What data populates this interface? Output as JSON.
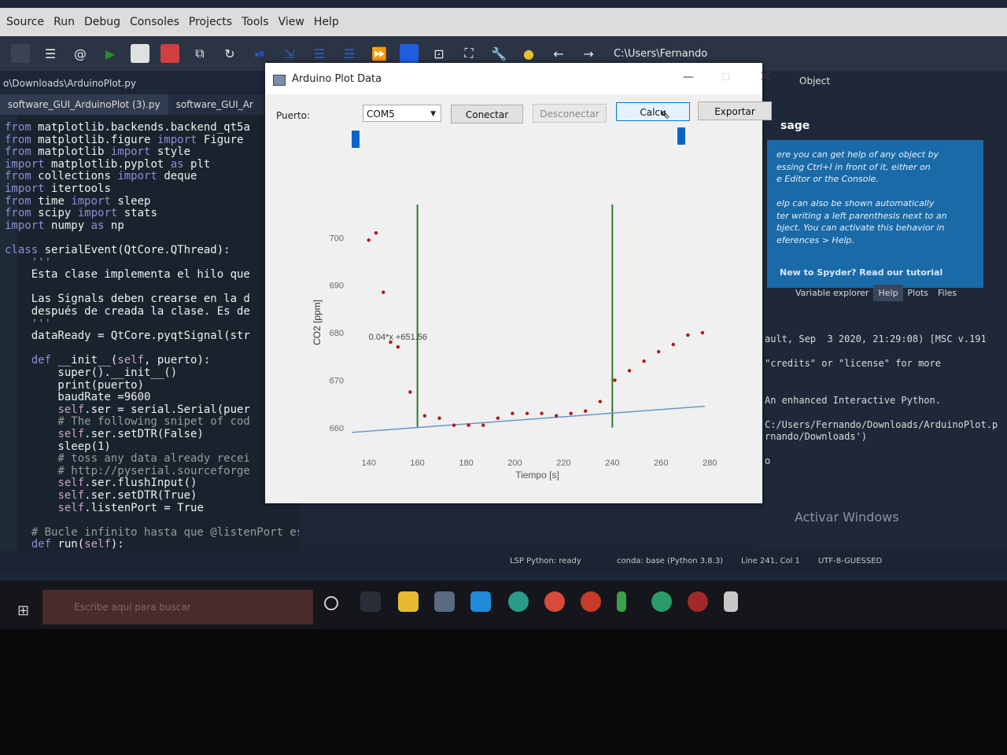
{
  "ide": {
    "menu": [
      "Source",
      "Run",
      "Debug",
      "Consoles",
      "Projects",
      "Tools",
      "View",
      "Help"
    ],
    "toolbar_path": "C:\\Users\\Fernando",
    "file_path": "o\\Downloads\\ArduinoPlot.py",
    "file_tabs": [
      "software_GUI_ArduinoPlot (3).py",
      "software_GUI_Ar"
    ],
    "code": [
      {
        "parts": [
          {
            "t": "from ",
            "c": "kw"
          },
          {
            "t": "matplotlib.backends.backend_qt5a",
            "c": ""
          }
        ]
      },
      {
        "parts": [
          {
            "t": "from ",
            "c": "kw"
          },
          {
            "t": "matplotlib.figure ",
            "c": ""
          },
          {
            "t": "import ",
            "c": "kw"
          },
          {
            "t": "Figure",
            "c": ""
          }
        ]
      },
      {
        "parts": [
          {
            "t": "from ",
            "c": "kw"
          },
          {
            "t": "matplotlib ",
            "c": ""
          },
          {
            "t": "import ",
            "c": "kw"
          },
          {
            "t": "style",
            "c": ""
          }
        ]
      },
      {
        "parts": [
          {
            "t": "import ",
            "c": "kw"
          },
          {
            "t": "matplotlib.pyplot ",
            "c": ""
          },
          {
            "t": "as ",
            "c": "kw"
          },
          {
            "t": "plt",
            "c": ""
          }
        ]
      },
      {
        "parts": [
          {
            "t": "from ",
            "c": "kw"
          },
          {
            "t": "collections ",
            "c": ""
          },
          {
            "t": "import ",
            "c": "kw"
          },
          {
            "t": "deque",
            "c": ""
          }
        ]
      },
      {
        "parts": [
          {
            "t": "import ",
            "c": "kw"
          },
          {
            "t": "itertools",
            "c": ""
          }
        ]
      },
      {
        "parts": [
          {
            "t": "from ",
            "c": "kw"
          },
          {
            "t": "time ",
            "c": ""
          },
          {
            "t": "import ",
            "c": "kw"
          },
          {
            "t": "sleep",
            "c": ""
          }
        ]
      },
      {
        "parts": [
          {
            "t": "from ",
            "c": "kw"
          },
          {
            "t": "scipy ",
            "c": ""
          },
          {
            "t": "import ",
            "c": "kw"
          },
          {
            "t": "stats",
            "c": ""
          }
        ]
      },
      {
        "parts": [
          {
            "t": "import ",
            "c": "kw"
          },
          {
            "t": "numpy ",
            "c": ""
          },
          {
            "t": "as ",
            "c": "kw"
          },
          {
            "t": "np",
            "c": ""
          }
        ]
      },
      {
        "parts": [
          {
            "t": "",
            "c": ""
          }
        ]
      },
      {
        "parts": [
          {
            "t": "class ",
            "c": "kw"
          },
          {
            "t": "serialEvent(QtCore.QThread):",
            "c": ""
          }
        ]
      },
      {
        "parts": [
          {
            "t": "    '''",
            "c": "cm"
          }
        ]
      },
      {
        "parts": [
          {
            "t": "    Esta clase implementa el hilo que",
            "c": ""
          }
        ]
      },
      {
        "parts": [
          {
            "t": "",
            "c": ""
          }
        ]
      },
      {
        "parts": [
          {
            "t": "    Las Signals deben crearse en la d",
            "c": ""
          }
        ]
      },
      {
        "parts": [
          {
            "t": "    después de creada la clase. Es de",
            "c": ""
          }
        ]
      },
      {
        "parts": [
          {
            "t": "    '''",
            "c": "cm"
          }
        ]
      },
      {
        "parts": [
          {
            "t": "    dataReady = QtCore.pyqtSignal(str",
            "c": ""
          }
        ]
      },
      {
        "parts": [
          {
            "t": "",
            "c": ""
          }
        ]
      },
      {
        "parts": [
          {
            "t": "    def ",
            "c": "kw"
          },
          {
            "t": "__init__(",
            "c": ""
          },
          {
            "t": "self",
            "c": "sf"
          },
          {
            "t": ", puerto):",
            "c": ""
          }
        ]
      },
      {
        "parts": [
          {
            "t": "        super().__init__()",
            "c": ""
          }
        ]
      },
      {
        "parts": [
          {
            "t": "        print(puerto)",
            "c": ""
          }
        ]
      },
      {
        "parts": [
          {
            "t": "        baudRate =9600",
            "c": ""
          }
        ]
      },
      {
        "parts": [
          {
            "t": "        ",
            "c": ""
          },
          {
            "t": "self",
            "c": "sf"
          },
          {
            "t": ".ser = serial.Serial(puer",
            "c": ""
          }
        ]
      },
      {
        "parts": [
          {
            "t": "        # The following snipet of cod",
            "c": "cm"
          }
        ]
      },
      {
        "parts": [
          {
            "t": "        ",
            "c": ""
          },
          {
            "t": "self",
            "c": "sf"
          },
          {
            "t": ".ser.setDTR(False)",
            "c": ""
          }
        ]
      },
      {
        "parts": [
          {
            "t": "        sleep(1)",
            "c": ""
          }
        ]
      },
      {
        "parts": [
          {
            "t": "        # toss any data already recei",
            "c": "cm"
          }
        ]
      },
      {
        "parts": [
          {
            "t": "        # http://pyserial.sourceforge",
            "c": "cm"
          }
        ]
      },
      {
        "parts": [
          {
            "t": "        ",
            "c": ""
          },
          {
            "t": "self",
            "c": "sf"
          },
          {
            "t": ".ser.flushInput()",
            "c": ""
          }
        ]
      },
      {
        "parts": [
          {
            "t": "        ",
            "c": ""
          },
          {
            "t": "self",
            "c": "sf"
          },
          {
            "t": ".ser.setDTR(True)",
            "c": ""
          }
        ]
      },
      {
        "parts": [
          {
            "t": "        ",
            "c": ""
          },
          {
            "t": "self",
            "c": "sf"
          },
          {
            "t": ".listenPort = True",
            "c": ""
          }
        ]
      },
      {
        "parts": [
          {
            "t": "",
            "c": ""
          }
        ]
      },
      {
        "parts": [
          {
            "t": "    # Bucle infinito hasta que @listenPort es False",
            "c": "cm"
          }
        ]
      },
      {
        "parts": [
          {
            "t": "    def ",
            "c": "kw"
          },
          {
            "t": "run(",
            "c": ""
          },
          {
            "t": "self",
            "c": "sf"
          },
          {
            "t": "):",
            "c": ""
          }
        ]
      }
    ],
    "object_label": "Object",
    "help_title": "sage",
    "help_lines": [
      "ere you can get help of any object by",
      "essing Ctrl+I in front of it, either on",
      "e Editor or the Console.",
      "",
      "elp can also be shown automatically",
      "ter writing a left parenthesis next to an",
      "bject. You can activate this behavior in",
      "eferences > Help."
    ],
    "help_link": "New to Spyder? Read our tutorial",
    "pane_tabs": [
      "Variable explorer",
      "Help",
      "Plots",
      "Files"
    ],
    "console_lines": [
      "ault, Sep  3 2020, 21:29:08) [MSC v.191",
      "",
      "\"credits\" or \"license\" for more",
      "",
      "",
      "An enhanced Interactive Python.",
      "",
      "C:/Users/Fernando/Downloads/ArduinoPlot.p",
      "rnando/Downloads')",
      "",
      "o"
    ],
    "activar_windows": "Activar Windows",
    "status": {
      "lsp": "LSP Python: ready",
      "conda": "conda: base (Python 3.8.3)",
      "line": "Line 241, Col 1",
      "encoding": "UTF-8-GUESSED"
    },
    "search_placeholder": "Escribe aquí para buscar"
  },
  "dialog": {
    "title": "Arduino Plot Data",
    "puerto_label": "Puerto:",
    "port_value": "COM5",
    "buttons": {
      "conectar": "Conectar",
      "desconectar": "Desconectar",
      "calcular": "Calcu",
      "exportar": "Exportar"
    },
    "slider_left_position": 0.0,
    "slider_right_position": 1.0
  },
  "chart_data": {
    "type": "scatter",
    "xlabel": "Tiempo [s]",
    "ylabel": "CO2 [ppm]",
    "xlim": [
      133,
      288
    ],
    "ylim": [
      654,
      707
    ],
    "x_ticks": [
      140,
      160,
      180,
      200,
      220,
      240,
      260,
      280
    ],
    "y_ticks": [
      660,
      670,
      680,
      690,
      700
    ],
    "annotation": "0.04*x +651.56",
    "annotation_pos": [
      140,
      678.5
    ],
    "points_x": [
      140,
      143,
      146,
      149,
      152,
      157,
      163,
      169,
      175,
      181,
      187,
      193,
      199,
      205,
      211,
      217,
      223,
      229,
      235,
      241,
      247,
      253,
      259,
      265,
      271,
      277
    ],
    "points_y": [
      699.5,
      701.0,
      688.5,
      678.0,
      677.0,
      667.5,
      662.5,
      662.0,
      660.5,
      660.5,
      660.5,
      662.0,
      663.0,
      663.0,
      663.0,
      662.5,
      663.0,
      663.5,
      665.5,
      670.0,
      672.0,
      674.0,
      676.0,
      677.5,
      679.5,
      680.0
    ],
    "fit_line": {
      "x": [
        133,
        278
      ],
      "y": [
        659.0,
        664.5
      ]
    },
    "vlines": [
      {
        "x": 160,
        "y": [
          660,
          707
        ]
      },
      {
        "x": 240,
        "y": [
          660,
          707
        ]
      }
    ],
    "colors": {
      "points": "#b01818",
      "fit": "#6a96c8",
      "vlines": "#2c7a2c"
    }
  }
}
